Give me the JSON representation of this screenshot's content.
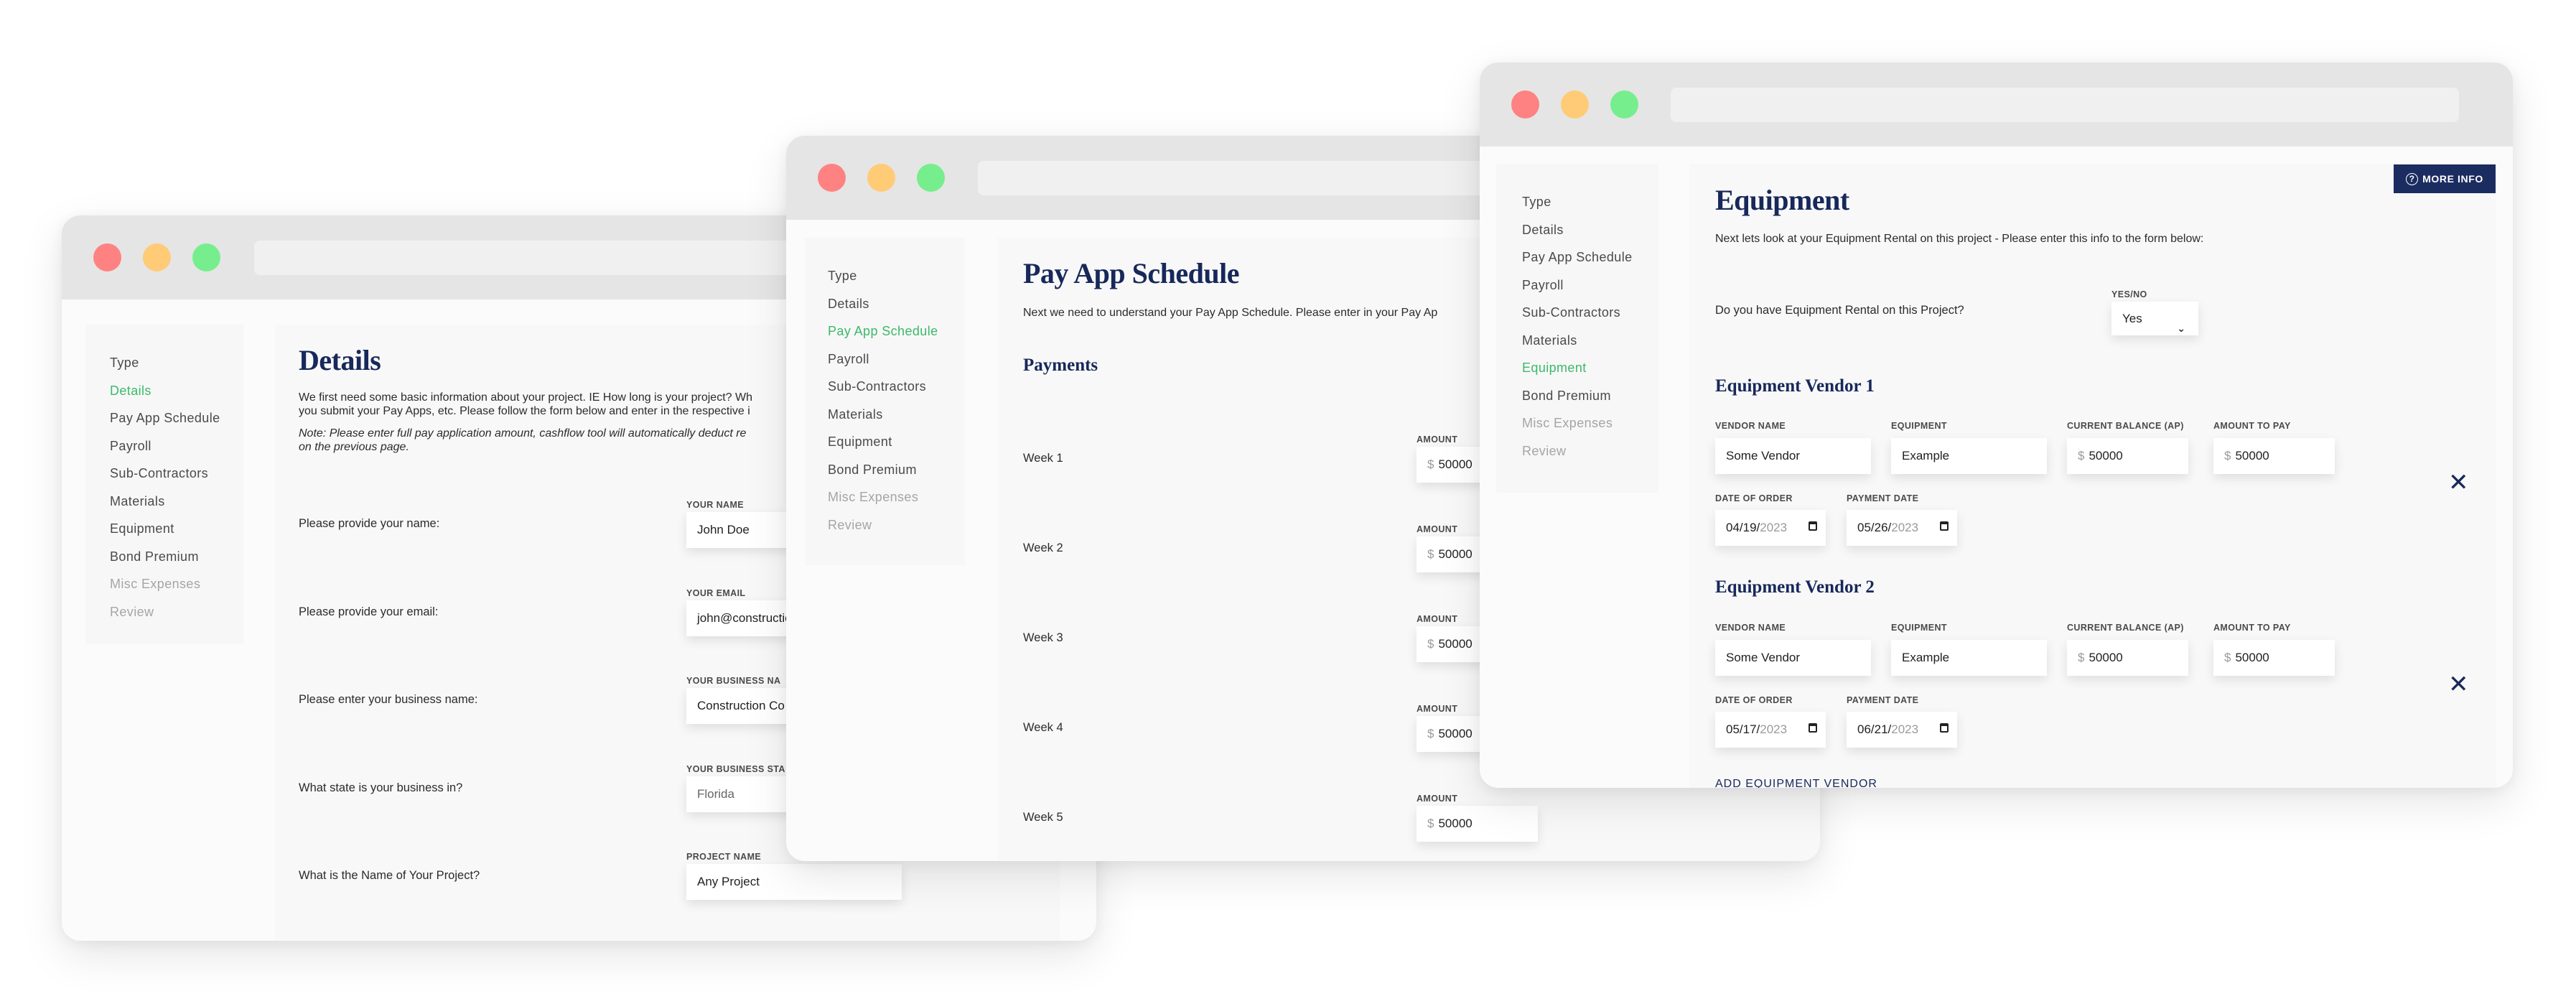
{
  "sidebar_items": [
    {
      "label": "Type"
    },
    {
      "label": "Details"
    },
    {
      "label": "Pay App Schedule"
    },
    {
      "label": "Payroll"
    },
    {
      "label": "Sub-Contractors"
    },
    {
      "label": "Materials"
    },
    {
      "label": "Equipment"
    },
    {
      "label": "Bond Premium"
    },
    {
      "label": "Misc Expenses"
    },
    {
      "label": "Review"
    }
  ],
  "colors": {
    "active_nav": "#3cb96a",
    "heading": "#17285a",
    "button_bg": "#1b2c60",
    "traffic_red": "#ff8282",
    "traffic_yellow": "#ffcb76",
    "traffic_green": "#76ee8d"
  },
  "details_window": {
    "active_item": "Details",
    "title": "Details",
    "intro_line1": "We first need some basic information about your project. IE How long is your project? Wh",
    "intro_line2": "you submit your Pay Apps, etc. Please follow the form below and enter in the respective i",
    "note_line1": "Note: Please enter full pay application amount, cashflow tool will automatically deduct re",
    "note_line2": "on the previous page.",
    "fields": [
      {
        "question": "Please provide your name:",
        "label": "Your Name",
        "value": "John Doe"
      },
      {
        "question": "Please provide your email:",
        "label": "Your Email",
        "value": "john@constructio"
      },
      {
        "question": "Please enter your business name:",
        "label": "Your Business Na",
        "value": "Construction Co"
      },
      {
        "question": "What state is your business in?",
        "label": "Your Business Sta",
        "value": "Florida"
      },
      {
        "question": "What is the Name of Your Project?",
        "label": "Project Name",
        "value": "Any Project"
      }
    ]
  },
  "payapp_window": {
    "active_item": "Pay App Schedule",
    "title": "Pay App Schedule",
    "intro": "Next we need to understand your Pay App Schedule. Please enter in your Pay Ap",
    "section_title": "Payments",
    "amount_label": "Amount",
    "currency_symbol": "$",
    "payments": [
      {
        "week": "Week 1",
        "amount": "50000"
      },
      {
        "week": "Week 2",
        "amount": "50000"
      },
      {
        "week": "Week 3",
        "amount": "50000"
      },
      {
        "week": "Week 4",
        "amount": "50000"
      },
      {
        "week": "Week 5",
        "amount": "50000"
      }
    ]
  },
  "equipment_window": {
    "active_item": "Equipment",
    "title": "Equipment",
    "more_info_label": "MORE INFO",
    "intro": "Next lets look at your Equipment Rental on this project - Please enter this info to the form below:",
    "rental_question": "Do you have Equipment Rental on this Project?",
    "yes_no_label": "Yes/No",
    "yes_no_value": "Yes",
    "labels": {
      "vendor_name": "Vendor Name",
      "equipment": "Equipment",
      "current_balance": "Current Balance (AP)",
      "amount_to_pay": "Amount To Pay",
      "date_of_order": "Date of Order",
      "payment_date": "Payment Date"
    },
    "currency_symbol": "$",
    "vendors": [
      {
        "title": "Equipment Vendor 1",
        "vendor_name": "Some Vendor",
        "equipment": "Example",
        "current_balance": "50000",
        "amount_to_pay": "50000",
        "date_of_order_md": "04/19/",
        "date_of_order_year": "2023",
        "payment_date_md": "05/26/",
        "payment_date_year": "2023"
      },
      {
        "title": "Equipment Vendor 2",
        "vendor_name": "Some Vendor",
        "equipment": "Example",
        "current_balance": "50000",
        "amount_to_pay": "50000",
        "date_of_order_md": "05/17/",
        "date_of_order_year": "2023",
        "payment_date_md": "06/21/",
        "payment_date_year": "2023"
      }
    ],
    "add_vendor_label": "ADD EQUIPMENT VENDOR",
    "remove_icon": "✕"
  }
}
